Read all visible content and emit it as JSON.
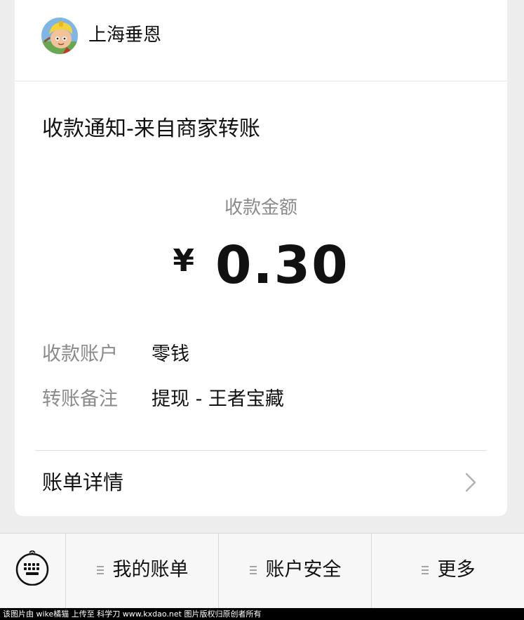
{
  "merchant": {
    "name": "上海垂恩",
    "avatar_icon": "cartoon-character-avatar"
  },
  "notice": {
    "title": "收款通知-来自商家转账"
  },
  "amount": {
    "label": "收款金额",
    "currency": "¥",
    "value": "0.30"
  },
  "details": [
    {
      "key": "收款账户",
      "value": "零钱"
    },
    {
      "key": "转账备注",
      "value": "提现 - 王者宝藏"
    }
  ],
  "bill": {
    "label": "账单详情",
    "icon": "chevron-right-icon"
  },
  "menu": {
    "keyboard_icon": "keyboard-icon",
    "items": [
      {
        "label": "我的账单",
        "icon": "menu-lines-icon"
      },
      {
        "label": "账户安全",
        "icon": "menu-lines-icon"
      },
      {
        "label": "更多",
        "icon": "menu-lines-icon"
      }
    ]
  },
  "watermark": {
    "text": "该图片由 wike橘猫 上传至 科学刀 www.kxdao.net 图片版权归原创者所有"
  },
  "colors": {
    "background": "#ededed",
    "card": "#ffffff",
    "muted_text": "#8a8a8a",
    "menubar": "#f7f7f7"
  }
}
